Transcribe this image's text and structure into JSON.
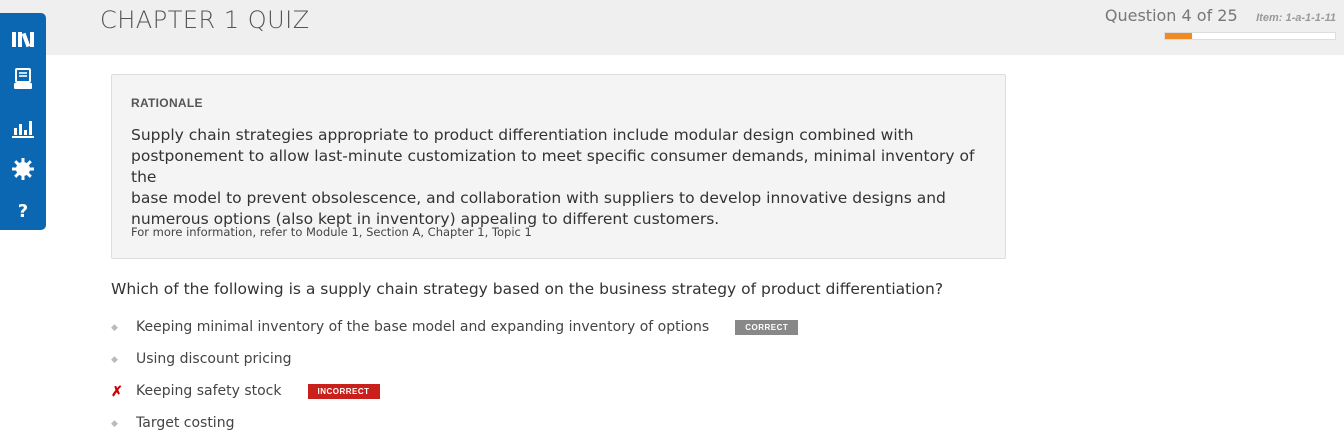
{
  "header": {
    "title": "CHAPTER 1 QUIZ",
    "question_counter": "Question 4 of 25",
    "item_id": "Item: 1-a-1-1-11",
    "progress": 0.16,
    "accent_color": "#f08a24"
  },
  "sidebar": {
    "color": "#0b67b2",
    "items": [
      {
        "icon": "library-icon"
      },
      {
        "icon": "flashcards-icon"
      },
      {
        "icon": "bar-chart-icon"
      },
      {
        "icon": "gear-icon"
      },
      {
        "icon": "help-icon",
        "label": "?"
      }
    ]
  },
  "rationale": {
    "heading": "RATIONALE",
    "lines": [
      "Supply chain strategies appropriate to product differentiation include modular design combined with",
      "postponement to allow last-minute customization to meet specific consumer demands, minimal inventory of the",
      "base model to prevent obsolescence, and collaboration with suppliers to develop innovative designs and",
      "numerous options (also kept in inventory) appealing to different customers."
    ],
    "reference": "For more information, refer to Module 1, Section A, Chapter 1, Topic 1"
  },
  "question": {
    "text": "Which of the following is a supply chain strategy based on the business strategy of product differentiation?",
    "options": [
      {
        "text": "Keeping minimal inventory of the base model and expanding inventory of options",
        "marker": "◆",
        "badge": "CORRECT"
      },
      {
        "text": "Using discount pricing",
        "marker": "◆",
        "badge": ""
      },
      {
        "text": "Keeping safety stock",
        "marker": "✗",
        "badge": "INCORRECT"
      },
      {
        "text": "Target costing",
        "marker": "◆",
        "badge": ""
      }
    ]
  }
}
